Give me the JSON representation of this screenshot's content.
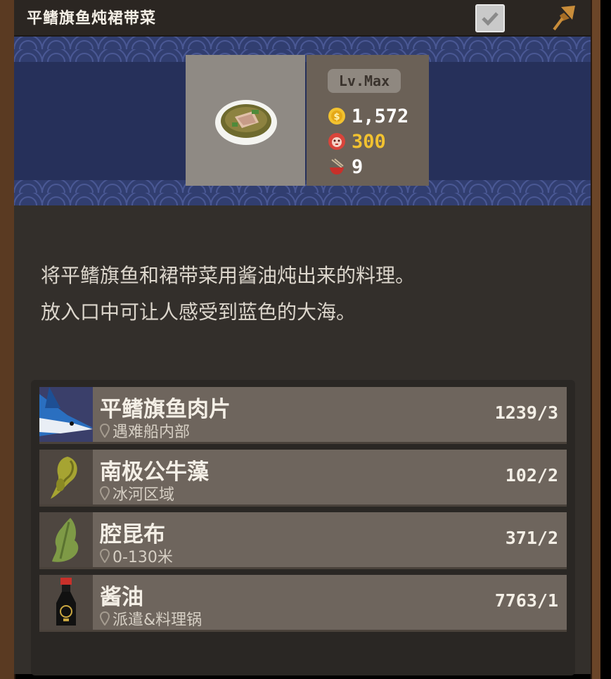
{
  "title": "平鳍旗鱼炖裙带菜",
  "theme": {
    "banner": "#26305a",
    "panel": "#332f2b",
    "gold": "#f2c230"
  },
  "dish": {
    "icon": "stew-bowl-icon",
    "level": "Lv.Max",
    "price": "1,572",
    "taste": "300",
    "servings": "9"
  },
  "description": [
    "将平鳍旗鱼和裙带菜用酱油炖出来的料理。",
    "放入口中可让人感受到蓝色的大海。"
  ],
  "ingredients": [
    {
      "name": "平鳍旗鱼肉片",
      "location": "遇难船内部",
      "count": "1239/3",
      "icon": "swordfish-icon"
    },
    {
      "name": "南极公牛藻",
      "location": "冰河区域",
      "count": "102/2",
      "icon": "bull-kelp-icon"
    },
    {
      "name": "腔昆布",
      "location": "0-130米",
      "count": "371/2",
      "icon": "kelp-leaf-icon"
    },
    {
      "name": "酱油",
      "location": "派遣&料理锅",
      "count": "7763/1",
      "icon": "soy-sauce-bottle-icon"
    }
  ]
}
